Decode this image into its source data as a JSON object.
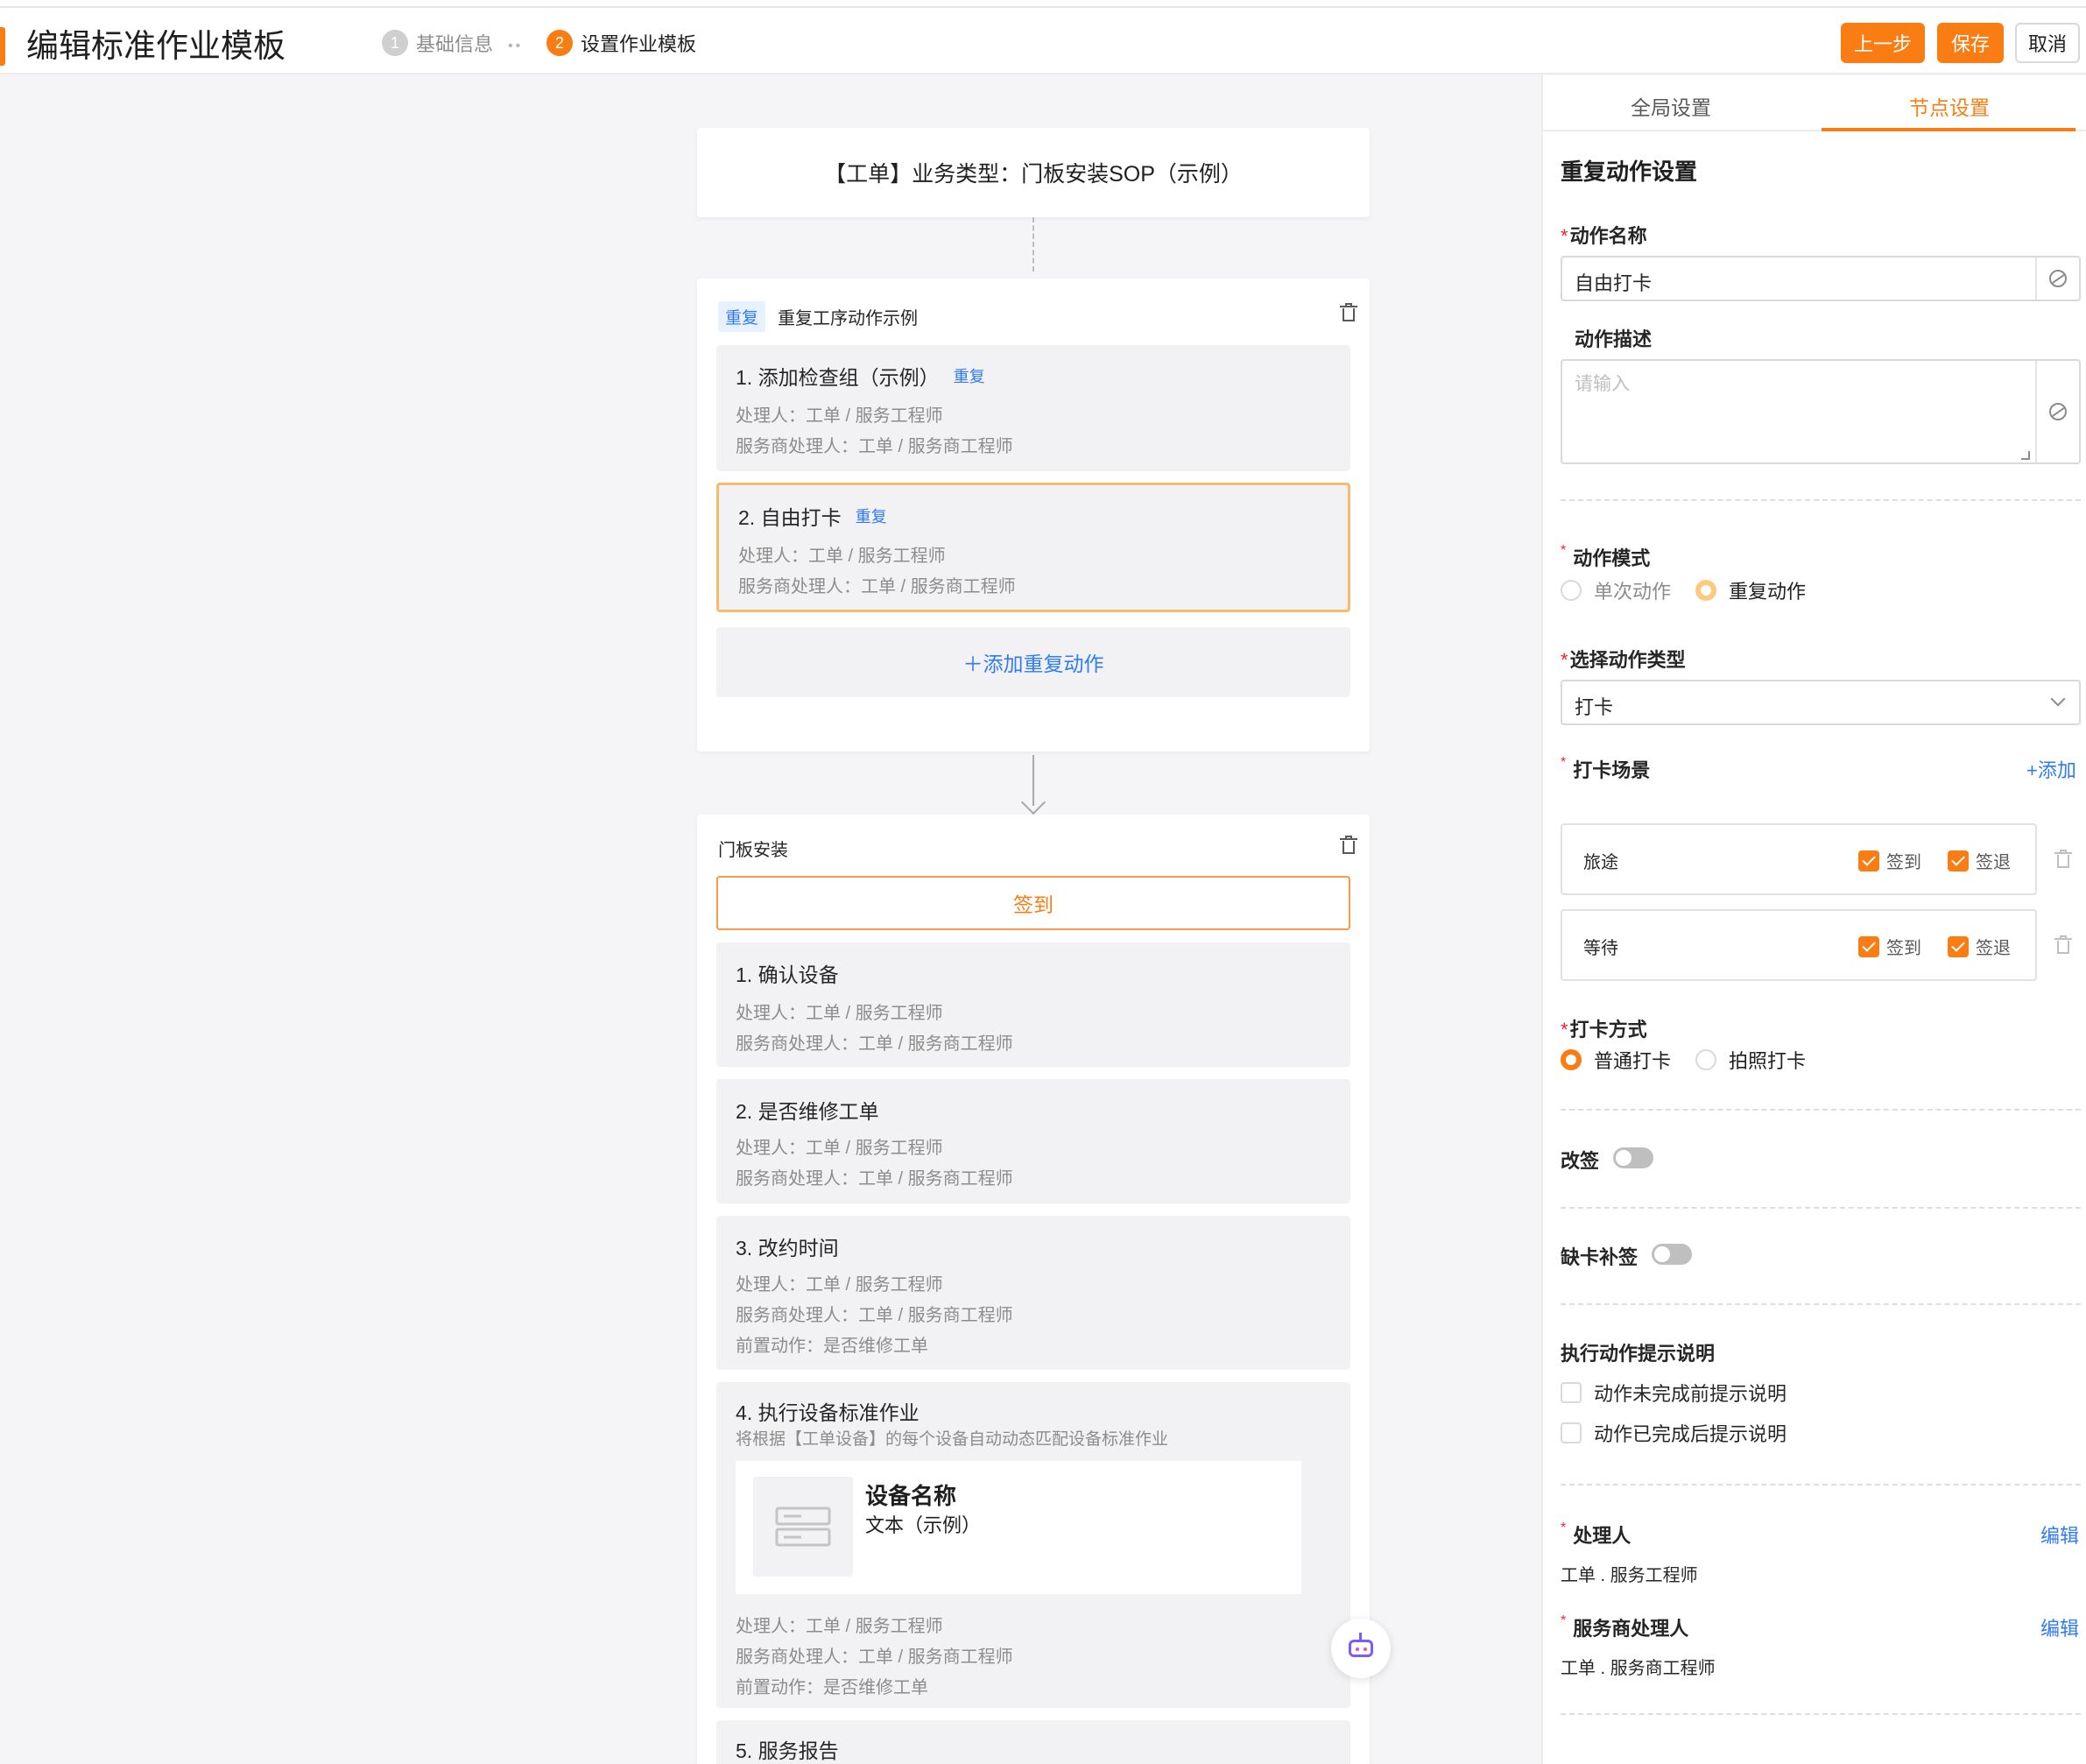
{
  "header": {
    "title": "编辑标准作业模板",
    "steps": [
      {
        "num": "1",
        "label": "基础信息"
      },
      {
        "num": "2",
        "label": "设置作业模板"
      }
    ],
    "step_separator": "••",
    "buttons": {
      "prev": "上一步",
      "save": "保存",
      "cancel": "取消"
    }
  },
  "canvas": {
    "top_card": "【工单】业务类型：门板安装SOP（示例）",
    "repeat_group": {
      "tag": "重复",
      "title": "重复工序动作示例",
      "actions": [
        {
          "name": "1. 添加检查组（示例）",
          "tag": "重复",
          "handler": "处理人：工单 / 服务工程师",
          "provider_handler": "服务商处理人：工单 / 服务商工程师"
        },
        {
          "name": "2. 自由打卡",
          "tag": "重复",
          "handler": "处理人：工单 / 服务工程师",
          "provider_handler": "服务商处理人：工单 / 服务商工程师"
        }
      ],
      "add_label": "＋添加重复动作"
    },
    "install_group": {
      "title": "门板安装",
      "checkin_label": "签到",
      "actions": [
        {
          "name": "1. 确认设备",
          "handler": "处理人：工单 / 服务工程师",
          "provider_handler": "服务商处理人：工单 / 服务商工程师"
        },
        {
          "name": "2. 是否维修工单",
          "handler": "处理人：工单 / 服务工程师",
          "provider_handler": "服务商处理人：工单 / 服务商工程师"
        },
        {
          "name": "3. 改约时间",
          "handler": "处理人：工单 / 服务工程师",
          "provider_handler": "服务商处理人：工单 / 服务商工程师",
          "pre_action": "前置动作：是否维修工单"
        },
        {
          "name": "4. 执行设备标准作业",
          "desc": "将根据【工单设备】的每个设备自动动态匹配设备标准作业",
          "device_name": "设备名称",
          "device_desc": "文本（示例）",
          "handler": "处理人：工单 / 服务工程师",
          "provider_handler": "服务商处理人：工单 / 服务商工程师",
          "pre_action": "前置动作：是否维修工单"
        },
        {
          "name": "5. 服务报告"
        }
      ]
    }
  },
  "panel": {
    "tabs": [
      "全局设置",
      "节点设置"
    ],
    "section_title": "重复动作设置",
    "action_name_label": "动作名称",
    "action_name_value": "自由打卡",
    "action_desc_label": "动作描述",
    "action_desc_placeholder": "请输入",
    "mode_label": "动作模式",
    "mode_options": [
      "单次动作",
      "重复动作"
    ],
    "type_label": "选择动作类型",
    "type_value": "打卡",
    "scene_label": "打卡场景",
    "scene_add": "+添加",
    "scenes": [
      {
        "name": "旅途",
        "checkin": "签到",
        "checkout": "签退"
      },
      {
        "name": "等待",
        "checkin": "签到",
        "checkout": "签退"
      }
    ],
    "method_label": "打卡方式",
    "method_options": [
      "普通打卡",
      "拍照打卡"
    ],
    "resign_label": "改签",
    "makeup_label": "缺卡补签",
    "tips_label": "执行动作提示说明",
    "tips_options": [
      "动作未完成前提示说明",
      "动作已完成后提示说明"
    ],
    "handler_label": "处理人",
    "handler_edit": "编辑",
    "handler_value": "工单 . 服务工程师",
    "provider_label": "服务商处理人",
    "provider_edit": "编辑",
    "provider_value": "工单 . 服务商工程师"
  },
  "colors": {
    "accent": "#fa7d13",
    "link": "#2f7bf5",
    "required": "#f5222d"
  }
}
